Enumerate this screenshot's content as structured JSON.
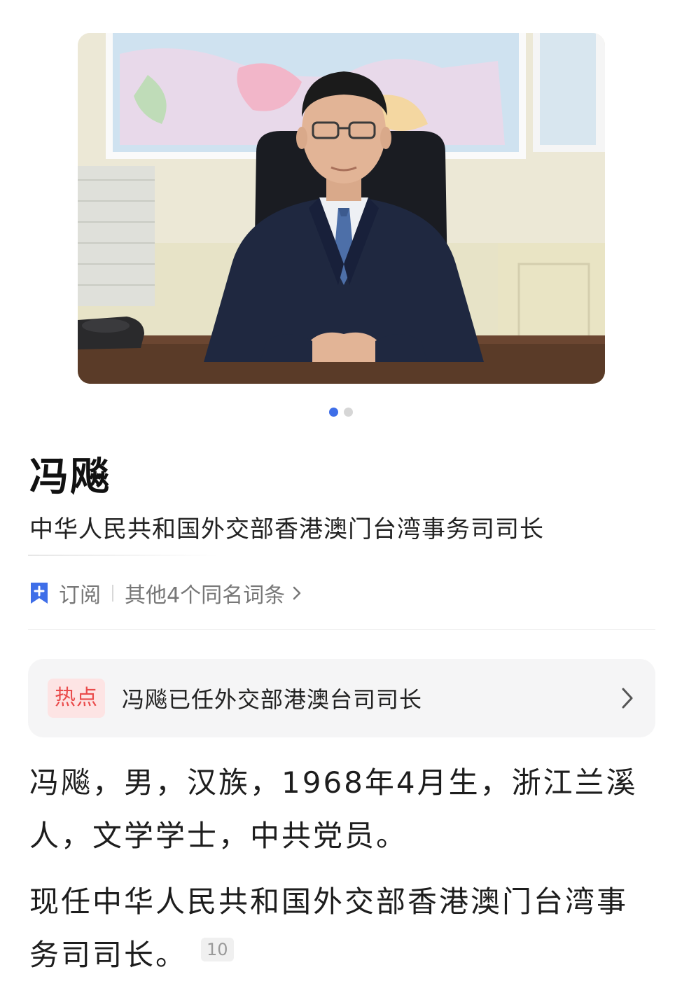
{
  "carousel": {
    "count": 2,
    "active": 1
  },
  "person": {
    "name": "冯飚",
    "title": "中华人民共和国外交部香港澳门台湾事务司司长"
  },
  "meta": {
    "subscribe_label": "订阅",
    "homonyms_label": "其他4个同名词条"
  },
  "hot": {
    "badge": "热点",
    "text": "冯飚已任外交部港澳台司司长"
  },
  "body": {
    "paragraph1": "冯飚，男，汉族，1968年4月生，浙江兰溪人，文学学士，中共党员。",
    "paragraph2": "现任中华人民共和国外交部香港澳门台湾事务司司长。",
    "ref_number": "10"
  },
  "colors": {
    "accent": "#3e6ee8",
    "hot_red": "#ea4b4b",
    "hot_bg": "#fde4e4",
    "card_bg": "#f5f5f6"
  }
}
